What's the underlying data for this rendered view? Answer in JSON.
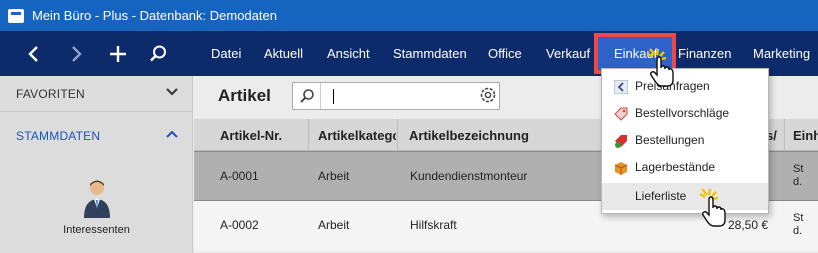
{
  "window": {
    "title": "Mein Büro - Plus - Datenbank: Demodaten"
  },
  "nav": {
    "menu": [
      "Datei",
      "Aktuell",
      "Ansicht",
      "Stammdaten",
      "Office",
      "Verkauf",
      "Einkauf",
      "Finanzen",
      "Marketing"
    ],
    "active": "Einkauf"
  },
  "sidebar": {
    "favoriten": "FAVORITEN",
    "stammdaten": "STAMMDATEN",
    "interessenten": "Interessenten"
  },
  "main": {
    "title": "Artikel",
    "search": {
      "value": "",
      "placeholder": ""
    },
    "columns": [
      "Artikel-Nr.",
      "Artikelkatego",
      "Artikelbezeichnung",
      "s/",
      "Einh"
    ],
    "rows": [
      {
        "nr": "A-0001",
        "kategorie": "Arbeit",
        "bezeichnung": "Kundendienstmonteur",
        "preis": "",
        "einheit": "St d."
      },
      {
        "nr": "A-0002",
        "kategorie": "Arbeit",
        "bezeichnung": "Hilfskraft",
        "preis": "28,50 €",
        "einheit": "St d."
      }
    ]
  },
  "dropdown": {
    "items": [
      "Preisanfragen",
      "Bestellvorschläge",
      "Bestellungen",
      "Lagerbestände",
      "Lieferliste"
    ],
    "hovered": "Lieferliste"
  },
  "colors": {
    "titlebar": "#1565c0",
    "navbar": "#0d2b6b",
    "active_menu": "#2d62c8",
    "highlight_border": "#f04848",
    "accent": "#1a56b8"
  }
}
